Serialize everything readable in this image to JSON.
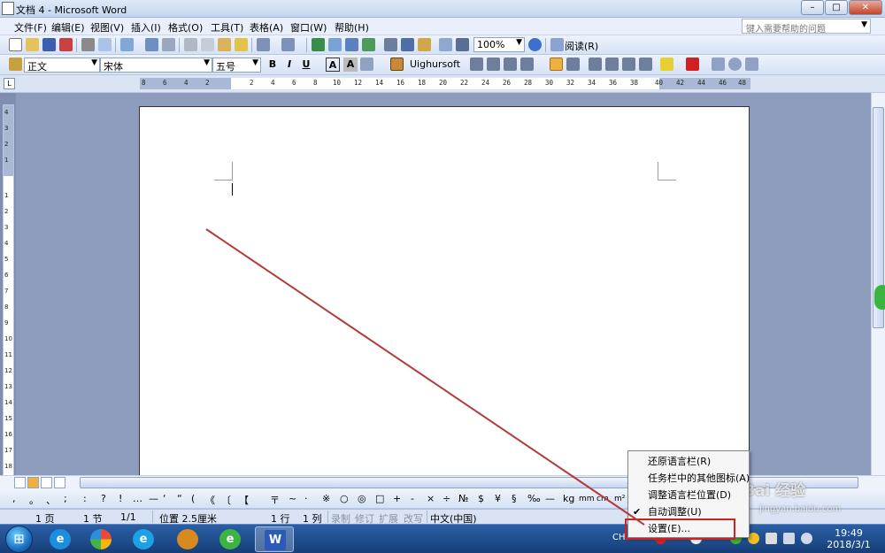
{
  "window": {
    "title": "文档 4 - Microsoft Word",
    "minimize": "–",
    "maximize": "□",
    "close": "✕"
  },
  "menubar": {
    "items": [
      "文件(F)",
      "编辑(E)",
      "视图(V)",
      "插入(I)",
      "格式(O)",
      "工具(T)",
      "表格(A)",
      "窗口(W)",
      "帮助(H)"
    ],
    "help_placeholder": "键入需要帮助的问题"
  },
  "toolbar1": {
    "zoom": "100%",
    "read_label": "阅读(R)"
  },
  "toolbar2": {
    "style": "正文",
    "font": "宋体",
    "size": "五号",
    "bold": "B",
    "italic": "I",
    "underline": "U",
    "char_border": "A",
    "char_shading": "A",
    "font_name2": "Uighursoft"
  },
  "ruler": {
    "corner": "L",
    "h_ticks": [
      "8",
      "6",
      "4",
      "2",
      "2",
      "4",
      "6",
      "8",
      "10",
      "12",
      "14",
      "16",
      "18",
      "20",
      "22",
      "24",
      "26",
      "28",
      "30",
      "32",
      "34",
      "36",
      "38",
      "40",
      "42",
      "44",
      "46",
      "48"
    ],
    "v_ticks": [
      "4",
      "3",
      "2",
      "1",
      "1",
      "2",
      "3",
      "4",
      "5",
      "6",
      "7",
      "8",
      "9",
      "10",
      "11",
      "12",
      "13",
      "14",
      "15",
      "16",
      "17",
      "18"
    ]
  },
  "symbolbar": {
    "symbols": [
      ",",
      "。",
      "、",
      ";",
      ":",
      "?",
      "!",
      "…",
      "—",
      "‘",
      "“",
      "(",
      "《",
      "〔",
      "【",
      "〒",
      "~",
      "·",
      "※",
      "○",
      "◎",
      "□",
      "+",
      "-",
      "×",
      "÷",
      "№",
      "$",
      "¥",
      "§",
      "‰",
      "—",
      "kg",
      "mm",
      "cm",
      "m²"
    ]
  },
  "statusbar": {
    "page": "1 页",
    "section": "1 节",
    "page_of": "1/1",
    "position": "位置 2.5厘米",
    "line": "1 行",
    "column": "1 列",
    "rec": "录制",
    "trk": "修订",
    "ext": "扩展",
    "ovr": "改写",
    "language": "中文(中国)"
  },
  "context_menu": {
    "items": [
      {
        "label": "还原语言栏(R)",
        "checked": false
      },
      {
        "label": "任务栏中的其他图标(A)",
        "checked": false
      },
      {
        "label": "调整语言栏位置(D)",
        "checked": false
      },
      {
        "label": "自动调整(U)",
        "checked": true
      },
      {
        "label": "设置(E)...",
        "checked": false
      }
    ],
    "check_glyph": "✔"
  },
  "taskbar": {
    "start": "⊞",
    "tray_lang": "CH",
    "time": "19:49",
    "date": "2018/3/1"
  },
  "watermark": {
    "main": "Bai 经验",
    "sub": "jingyan.baidu.com"
  },
  "colors": {
    "annotation": "#b23a3a",
    "highlight": "#cc2222",
    "doc_background": "#8d9bbd"
  }
}
